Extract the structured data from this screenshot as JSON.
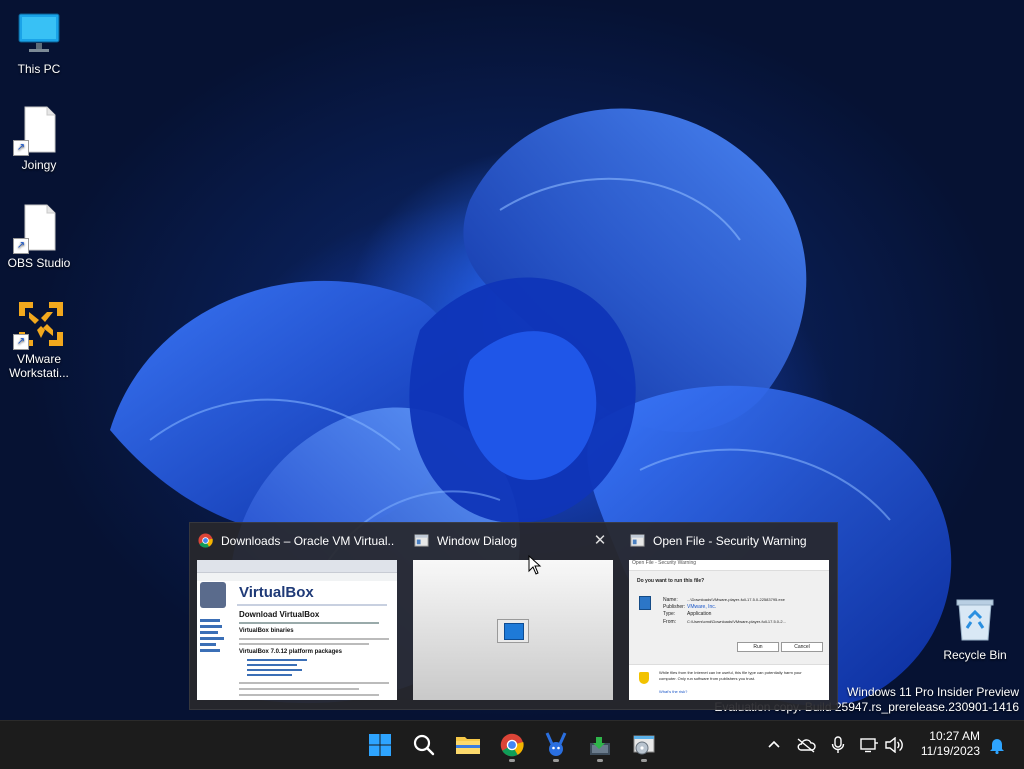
{
  "desktop_icons": [
    {
      "label": "This PC",
      "icon": "monitor-icon"
    },
    {
      "label": "Joingy",
      "icon": "document-shortcut-icon"
    },
    {
      "label": "OBS Studio",
      "icon": "document-shortcut-icon"
    },
    {
      "label": "VMware Workstati...",
      "label_line1": "VMware",
      "label_line2": "Workstati...",
      "icon": "vmware-icon"
    },
    {
      "label": "Recycle Bin",
      "icon": "recycle-bin-icon"
    }
  ],
  "watermark": {
    "line1": "Windows 11 Pro Insider Preview",
    "line2": "Evaluation copy. Build 25947.rs_prerelease.230901-1416"
  },
  "previews": [
    {
      "title": "Downloads – Oracle VM Virtual...",
      "app_icon": "chrome-icon",
      "content": {
        "heading": "VirtualBox",
        "subheading": "Download VirtualBox",
        "section1": "VirtualBox binaries",
        "section2": "VirtualBox 7.0.12 platform packages"
      }
    },
    {
      "title": "Window Dialog",
      "app_icon": "window-icon",
      "close": "✕"
    },
    {
      "title": "Open File - Security Warning",
      "app_icon": "window-icon",
      "content": {
        "window_title": "Open File - Security Warning",
        "question": "Do you want to run this file?",
        "name_label": "Name:",
        "name_value": "...\\Downloads\\VMware-player-full-17.5.0-22583795.exe",
        "publisher_label": "Publisher:",
        "publisher_value": "VMware, Inc.",
        "type_label": "Type:",
        "type_value": "Application",
        "from_label": "From:",
        "from_value": "C:\\Users\\cmd\\Downloads\\VMware-player-full-17.5.0-2...",
        "run_button": "Run",
        "cancel_button": "Cancel",
        "warning": "While files from the Internet can be useful, this file type can potentially harm your computer. Only run software from publishers you trust.",
        "risk_link": "What's the risk?"
      }
    }
  ],
  "taskbar": {
    "apps": [
      {
        "name": "start-button",
        "icon": "windows-logo-icon",
        "running": false
      },
      {
        "name": "search-button",
        "icon": "search-icon",
        "running": false
      },
      {
        "name": "file-explorer-button",
        "icon": "folder-icon",
        "running": false
      },
      {
        "name": "chrome-button",
        "icon": "chrome-icon",
        "running": true
      },
      {
        "name": "joingy-button",
        "icon": "bunny-icon",
        "running": true
      },
      {
        "name": "vmware-installer-button",
        "icon": "installer-icon",
        "running": true
      },
      {
        "name": "dialog-app-button",
        "icon": "disc-window-icon",
        "running": true
      }
    ],
    "tray": {
      "chevron": "^",
      "clock_time": "10:27 AM",
      "clock_date": "11/19/2023"
    }
  },
  "colors": {
    "taskbar": "#1c1c1c",
    "preview_bg": "#28282c",
    "accent_blue": "#1a56c8",
    "vmware_orange": "#f2a81d"
  }
}
